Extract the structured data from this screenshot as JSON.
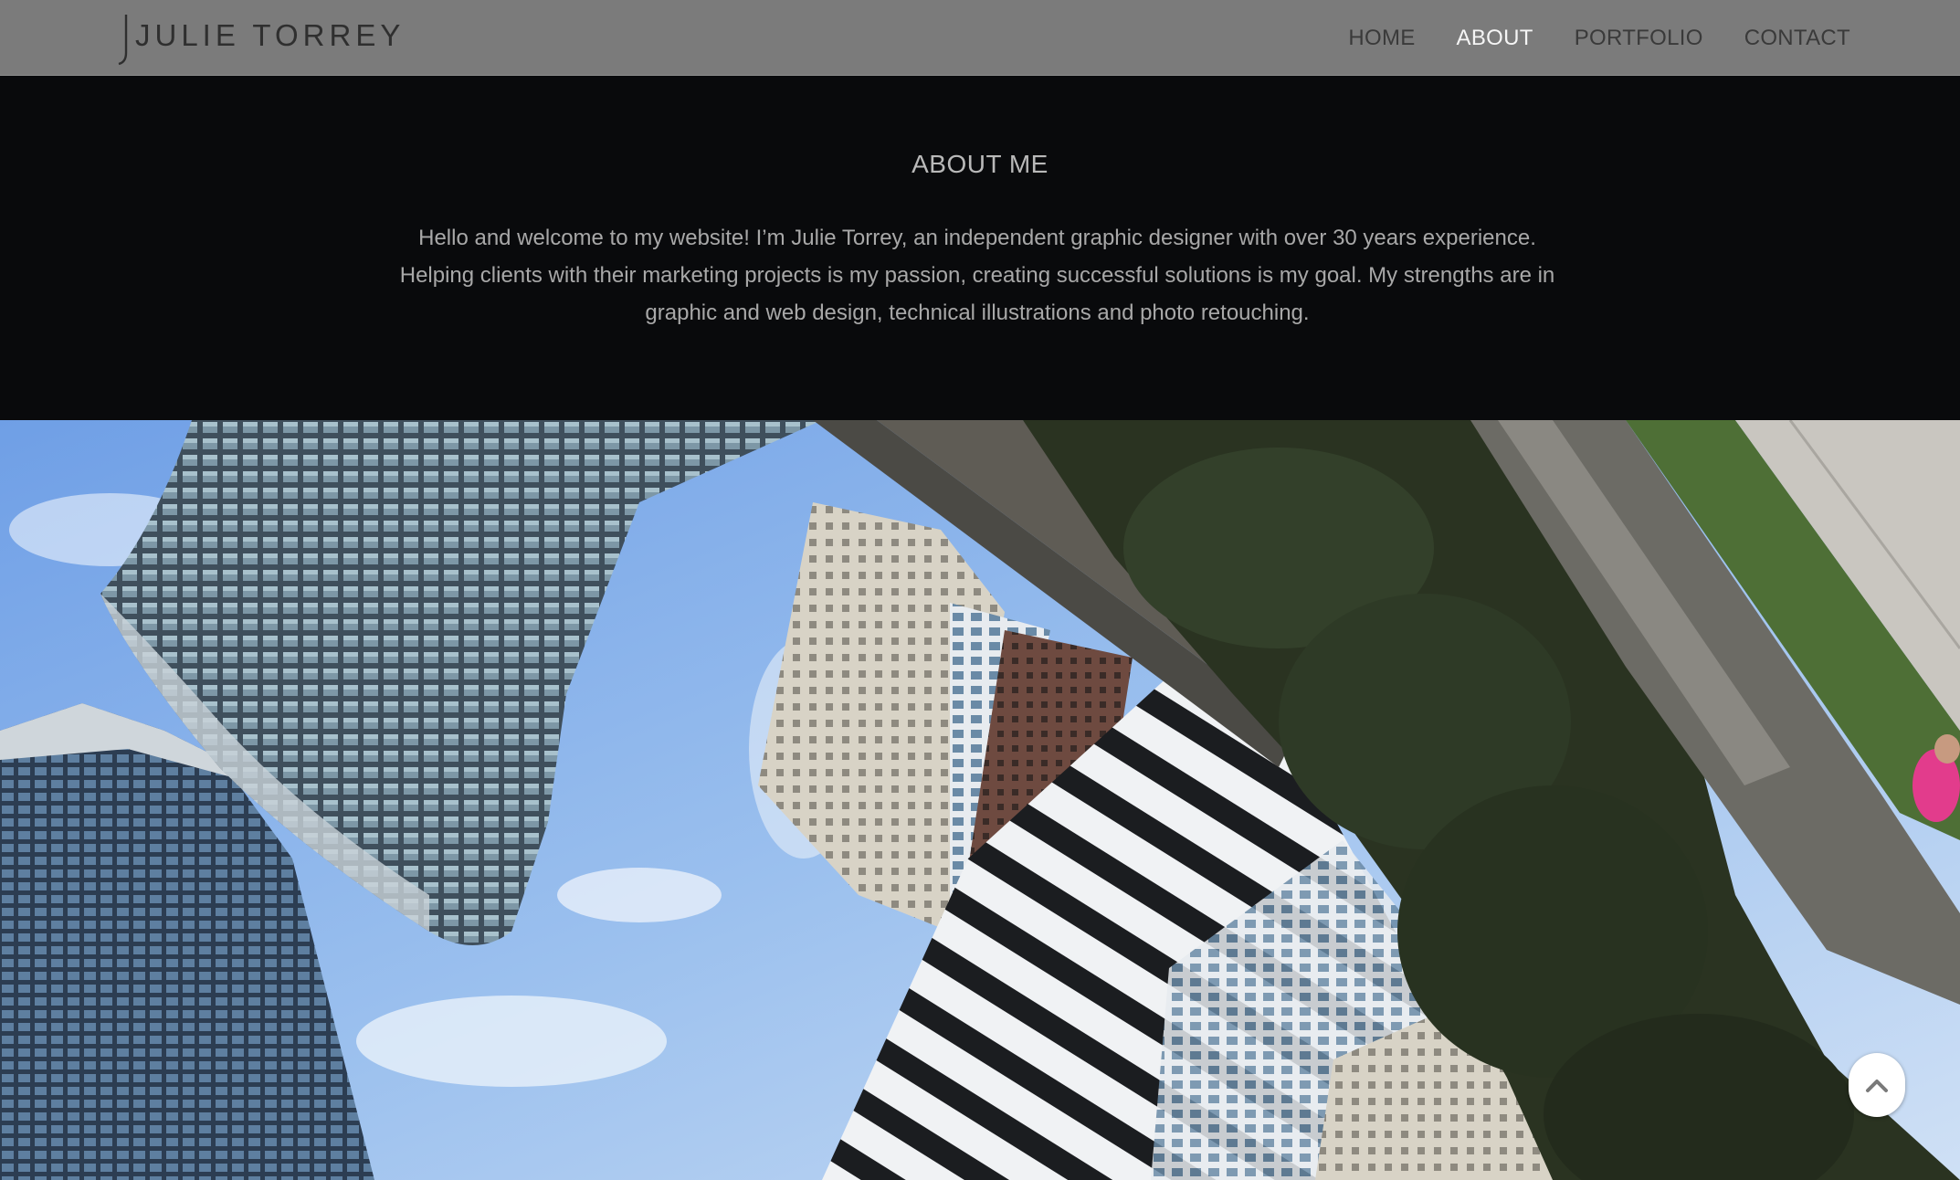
{
  "brand": {
    "logo_text": "JULIE TORREY"
  },
  "nav": {
    "items": [
      {
        "label": "HOME",
        "active": false
      },
      {
        "label": "ABOUT",
        "active": true
      },
      {
        "label": "PORTFOLIO",
        "active": false
      },
      {
        "label": "CONTACT",
        "active": false
      }
    ]
  },
  "about": {
    "title": "ABOUT ME",
    "body": "Hello and welcome to my website! I’m Julie Torrey, an independent graphic designer with over 30 years experience. Helping clients with their marketing projects is my passion, creating successful solutions is my goal. My strengths are in graphic and web design, technical illustrations and photo retouching."
  },
  "hero": {
    "icon": "city-skyline-photo"
  },
  "back_to_top": {
    "icon": "chevron-up-icon"
  },
  "colors": {
    "header_bg": "#7b7b7b",
    "section_bg": "#090a0c",
    "nav_active": "#f5f5f5",
    "nav_default": "#3a3a3a",
    "text_muted": "#a8a8a8"
  }
}
